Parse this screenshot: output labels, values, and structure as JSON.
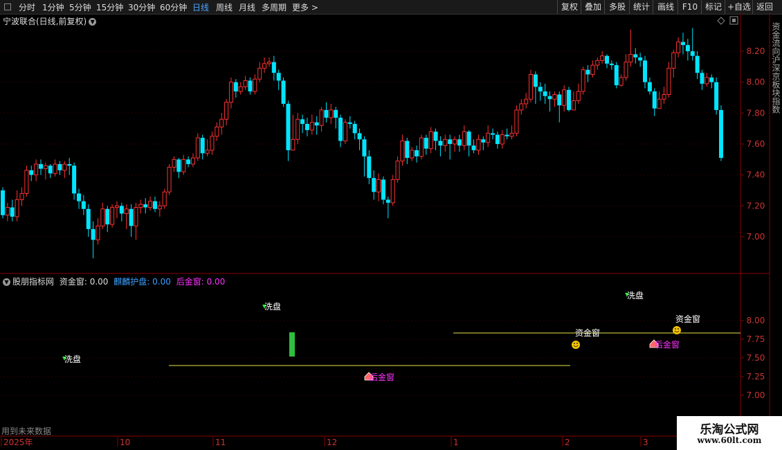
{
  "toolbar": {
    "periods": [
      "分时",
      "1分钟",
      "5分钟",
      "15分钟",
      "30分钟",
      "60分钟",
      "日线",
      "周线",
      "月线",
      "多周期",
      "更多 >"
    ],
    "active_period": "日线",
    "right_buttons": [
      "复权",
      "叠加",
      "多股",
      "统计",
      "画线",
      "F10",
      "标记",
      "+自选",
      "返回"
    ]
  },
  "main_chart": {
    "title": "宁波联合(日线,前复权)",
    "price_ticks": [
      "8.20",
      "8.00",
      "7.80",
      "7.60",
      "7.40",
      "7.20",
      "7.00"
    ]
  },
  "indicator_panel": {
    "name": "股朋指标网",
    "legend": [
      {
        "label": "资金窗:",
        "value": "0.00",
        "color": "#dddddd"
      },
      {
        "label": "麒麟护盘:",
        "value": "0.00",
        "color": "#3aa0ff"
      },
      {
        "label": "后金窗:",
        "value": "0.00",
        "color": "#ff33ff"
      }
    ],
    "ticks": [
      "8.00",
      "7.75",
      "7.50",
      "7.25",
      "7.00"
    ],
    "annotations": [
      {
        "text": "洗盘",
        "color": "#ffffff"
      },
      {
        "text": "洗盘",
        "color": "#ffffff"
      },
      {
        "text": "洗盘",
        "color": "#ffffff"
      },
      {
        "text": "后金窗",
        "color": "#ff33ff"
      },
      {
        "text": "资金窗",
        "color": "#ffffff"
      },
      {
        "text": "后金窗",
        "color": "#ff33ff"
      },
      {
        "text": "资金窗",
        "color": "#ffffff"
      }
    ],
    "future_data_note": "用到未来数据"
  },
  "date_axis": {
    "labels": [
      "2025年",
      "10",
      "11",
      "12",
      "1",
      "2",
      "3"
    ]
  },
  "right_sidebar": {
    "text": "资金流向沪深京板块指数"
  },
  "watermark": {
    "line1": "乐淘公式网",
    "line2": "www.60lt.com"
  },
  "chart_data": {
    "type": "candlestick",
    "y_range": [
      6.8,
      8.38
    ],
    "bullish_color": "#ff3232",
    "bearish_color": "#00e5ff",
    "candles": [
      [
        7.3,
        7.14,
        7.32,
        7.12
      ],
      [
        7.14,
        7.19,
        7.22,
        7.1
      ],
      [
        7.19,
        7.13,
        7.24,
        7.1
      ],
      [
        7.13,
        7.24,
        7.3,
        7.1
      ],
      [
        7.24,
        7.28,
        7.32,
        7.2
      ],
      [
        7.28,
        7.43,
        7.46,
        7.26
      ],
      [
        7.43,
        7.4,
        7.46,
        7.36
      ],
      [
        7.4,
        7.47,
        7.5,
        7.36
      ],
      [
        7.47,
        7.44,
        7.5,
        7.4
      ],
      [
        7.44,
        7.46,
        7.48,
        7.37
      ],
      [
        7.46,
        7.41,
        7.47,
        7.38
      ],
      [
        7.41,
        7.47,
        7.5,
        7.39
      ],
      [
        7.47,
        7.43,
        7.49,
        7.4
      ],
      [
        7.43,
        7.47,
        7.49,
        7.38
      ],
      [
        7.47,
        7.46,
        7.51,
        7.4
      ],
      [
        7.46,
        7.28,
        7.48,
        7.24
      ],
      [
        7.28,
        7.23,
        7.31,
        7.18
      ],
      [
        7.23,
        7.18,
        7.27,
        7.14
      ],
      [
        7.18,
        7.05,
        7.21,
        7.0
      ],
      [
        7.05,
        6.98,
        7.1,
        6.86
      ],
      [
        6.98,
        7.07,
        7.12,
        6.95
      ],
      [
        7.07,
        7.18,
        7.22,
        7.05
      ],
      [
        7.18,
        7.08,
        7.2,
        7.03
      ],
      [
        7.08,
        7.19,
        7.21,
        7.06
      ],
      [
        7.19,
        7.2,
        7.23,
        7.12
      ],
      [
        7.2,
        7.15,
        7.22,
        7.1
      ],
      [
        7.15,
        7.18,
        7.21,
        7.05
      ],
      [
        7.18,
        7.07,
        7.21,
        7.0
      ],
      [
        7.07,
        7.19,
        7.22,
        6.98
      ],
      [
        7.19,
        7.21,
        7.24,
        7.15
      ],
      [
        7.21,
        7.19,
        7.25,
        7.15
      ],
      [
        7.19,
        7.23,
        7.26,
        7.17
      ],
      [
        7.23,
        7.18,
        7.26,
        7.16
      ],
      [
        7.18,
        7.2,
        7.23,
        7.13
      ],
      [
        7.2,
        7.29,
        7.31,
        7.18
      ],
      [
        7.29,
        7.45,
        7.47,
        7.27
      ],
      [
        7.45,
        7.5,
        7.52,
        7.42
      ],
      [
        7.5,
        7.42,
        7.51,
        7.38
      ],
      [
        7.42,
        7.5,
        7.53,
        7.4
      ],
      [
        7.5,
        7.47,
        7.52,
        7.45
      ],
      [
        7.47,
        7.51,
        7.54,
        7.45
      ],
      [
        7.51,
        7.64,
        7.67,
        7.49
      ],
      [
        7.64,
        7.54,
        7.66,
        7.5
      ],
      [
        7.54,
        7.56,
        7.63,
        7.52
      ],
      [
        7.56,
        7.65,
        7.68,
        7.53
      ],
      [
        7.65,
        7.71,
        7.74,
        7.62
      ],
      [
        7.71,
        7.76,
        7.8,
        7.66
      ],
      [
        7.76,
        7.87,
        7.89,
        7.72
      ],
      [
        7.87,
        8.0,
        8.03,
        7.83
      ],
      [
        8.0,
        7.94,
        8.02,
        7.9
      ],
      [
        7.94,
        7.97,
        8.0,
        7.92
      ],
      [
        7.97,
        8.01,
        8.04,
        7.95
      ],
      [
        8.01,
        7.94,
        8.03,
        7.92
      ],
      [
        7.94,
        8.02,
        8.05,
        7.92
      ],
      [
        8.02,
        8.09,
        8.13,
        8.0
      ],
      [
        8.09,
        8.12,
        8.16,
        8.06
      ],
      [
        8.12,
        8.13,
        8.16,
        8.1
      ],
      [
        8.13,
        8.06,
        8.17,
        8.01
      ],
      [
        8.06,
        8.01,
        8.08,
        7.95
      ],
      [
        8.01,
        7.86,
        8.03,
        7.84
      ],
      [
        7.86,
        7.56,
        7.88,
        7.49
      ],
      [
        7.56,
        7.63,
        7.79,
        7.6
      ],
      [
        7.63,
        7.76,
        7.8,
        7.6
      ],
      [
        7.76,
        7.73,
        7.79,
        7.67
      ],
      [
        7.73,
        7.69,
        7.77,
        7.65
      ],
      [
        7.69,
        7.74,
        7.79,
        7.66
      ],
      [
        7.74,
        7.72,
        7.78,
        7.66
      ],
      [
        7.72,
        7.82,
        7.84,
        7.68
      ],
      [
        7.82,
        7.77,
        7.87,
        7.74
      ],
      [
        7.77,
        7.82,
        7.86,
        7.73
      ],
      [
        7.82,
        7.77,
        7.84,
        7.7
      ],
      [
        7.77,
        7.62,
        7.79,
        7.58
      ],
      [
        7.62,
        7.74,
        7.76,
        7.6
      ],
      [
        7.74,
        7.73,
        7.78,
        7.7
      ],
      [
        7.73,
        7.67,
        7.75,
        7.63
      ],
      [
        7.67,
        7.63,
        7.7,
        7.56
      ],
      [
        7.63,
        7.52,
        7.65,
        7.39
      ],
      [
        7.52,
        7.38,
        7.56,
        7.34
      ],
      [
        7.38,
        7.29,
        7.43,
        7.24
      ],
      [
        7.29,
        7.37,
        7.41,
        7.23
      ],
      [
        7.37,
        7.24,
        7.39,
        7.21
      ],
      [
        7.24,
        7.22,
        7.26,
        7.12
      ],
      [
        7.22,
        7.37,
        7.4,
        7.2
      ],
      [
        7.37,
        7.49,
        7.52,
        7.35
      ],
      [
        7.49,
        7.62,
        7.66,
        7.46
      ],
      [
        7.62,
        7.51,
        7.64,
        7.47
      ],
      [
        7.51,
        7.56,
        7.58,
        7.49
      ],
      [
        7.56,
        7.52,
        7.59,
        7.48
      ],
      [
        7.52,
        7.64,
        7.66,
        7.5
      ],
      [
        7.64,
        7.57,
        7.66,
        7.53
      ],
      [
        7.57,
        7.68,
        7.71,
        7.54
      ],
      [
        7.68,
        7.62,
        7.7,
        7.56
      ],
      [
        7.62,
        7.59,
        7.65,
        7.52
      ],
      [
        7.59,
        7.63,
        7.66,
        7.55
      ],
      [
        7.63,
        7.6,
        7.66,
        7.5
      ],
      [
        7.6,
        7.63,
        7.65,
        7.55
      ],
      [
        7.63,
        7.59,
        7.66,
        7.55
      ],
      [
        7.59,
        7.68,
        7.72,
        7.56
      ],
      [
        7.68,
        7.59,
        7.69,
        7.52
      ],
      [
        7.59,
        7.56,
        7.63,
        7.54
      ],
      [
        7.56,
        7.63,
        7.66,
        7.53
      ],
      [
        7.63,
        7.61,
        7.65,
        7.56
      ],
      [
        7.61,
        7.67,
        7.72,
        7.58
      ],
      [
        7.67,
        7.66,
        7.7,
        7.63
      ],
      [
        7.66,
        7.6,
        7.68,
        7.57
      ],
      [
        7.6,
        7.66,
        7.69,
        7.57
      ],
      [
        7.66,
        7.65,
        7.7,
        7.63
      ],
      [
        7.65,
        7.67,
        7.72,
        7.63
      ],
      [
        7.67,
        7.82,
        7.85,
        7.65
      ],
      [
        7.82,
        7.86,
        7.89,
        7.79
      ],
      [
        7.86,
        7.89,
        7.93,
        7.83
      ],
      [
        7.89,
        8.05,
        8.08,
        7.87
      ],
      [
        8.05,
        7.97,
        8.07,
        7.86
      ],
      [
        7.97,
        7.94,
        8.0,
        7.88
      ],
      [
        7.94,
        7.91,
        7.99,
        7.86
      ],
      [
        7.91,
        7.89,
        7.94,
        7.81
      ],
      [
        7.89,
        7.92,
        7.94,
        7.84
      ],
      [
        7.92,
        7.85,
        7.94,
        7.74
      ],
      [
        7.85,
        7.95,
        7.98,
        7.81
      ],
      [
        7.95,
        7.82,
        7.97,
        7.81
      ],
      [
        7.82,
        7.88,
        7.94,
        7.83
      ],
      [
        7.88,
        7.94,
        7.99,
        7.86
      ],
      [
        7.94,
        8.08,
        8.1,
        7.92
      ],
      [
        8.08,
        8.05,
        8.11,
        8.0
      ],
      [
        8.05,
        8.11,
        8.14,
        8.03
      ],
      [
        8.11,
        8.14,
        8.16,
        8.08
      ],
      [
        8.14,
        8.17,
        8.2,
        8.12
      ],
      [
        8.17,
        8.12,
        8.18,
        8.09
      ],
      [
        8.12,
        8.11,
        8.14,
        8.08
      ],
      [
        8.11,
        7.98,
        8.13,
        7.96
      ],
      [
        7.98,
        8.03,
        8.05,
        7.97
      ],
      [
        8.03,
        8.13,
        8.18,
        8.01
      ],
      [
        8.13,
        8.18,
        8.34,
        8.1
      ],
      [
        8.18,
        8.16,
        8.22,
        8.12
      ],
      [
        8.16,
        8.14,
        8.19,
        8.1
      ],
      [
        8.14,
        8.0,
        8.17,
        7.96
      ],
      [
        8.0,
        7.94,
        8.03,
        7.92
      ],
      [
        7.94,
        7.83,
        7.96,
        7.78
      ],
      [
        7.83,
        7.89,
        7.94,
        7.87
      ],
      [
        7.89,
        7.92,
        7.97,
        7.86
      ],
      [
        7.92,
        8.09,
        8.13,
        7.9
      ],
      [
        8.09,
        8.19,
        8.21,
        8.03
      ],
      [
        8.19,
        8.26,
        8.29,
        8.16
      ],
      [
        8.26,
        8.24,
        8.32,
        8.18
      ],
      [
        8.24,
        8.2,
        8.28,
        8.14
      ],
      [
        8.2,
        8.17,
        8.35,
        8.14
      ],
      [
        8.17,
        8.06,
        8.2,
        8.02
      ],
      [
        8.06,
        7.99,
        8.08,
        7.95
      ],
      [
        7.99,
        8.03,
        8.06,
        7.97
      ],
      [
        8.03,
        8.0,
        8.05,
        7.96
      ],
      [
        8.0,
        7.82,
        8.03,
        7.79
      ],
      [
        7.82,
        7.51,
        7.85,
        7.49
      ]
    ]
  }
}
